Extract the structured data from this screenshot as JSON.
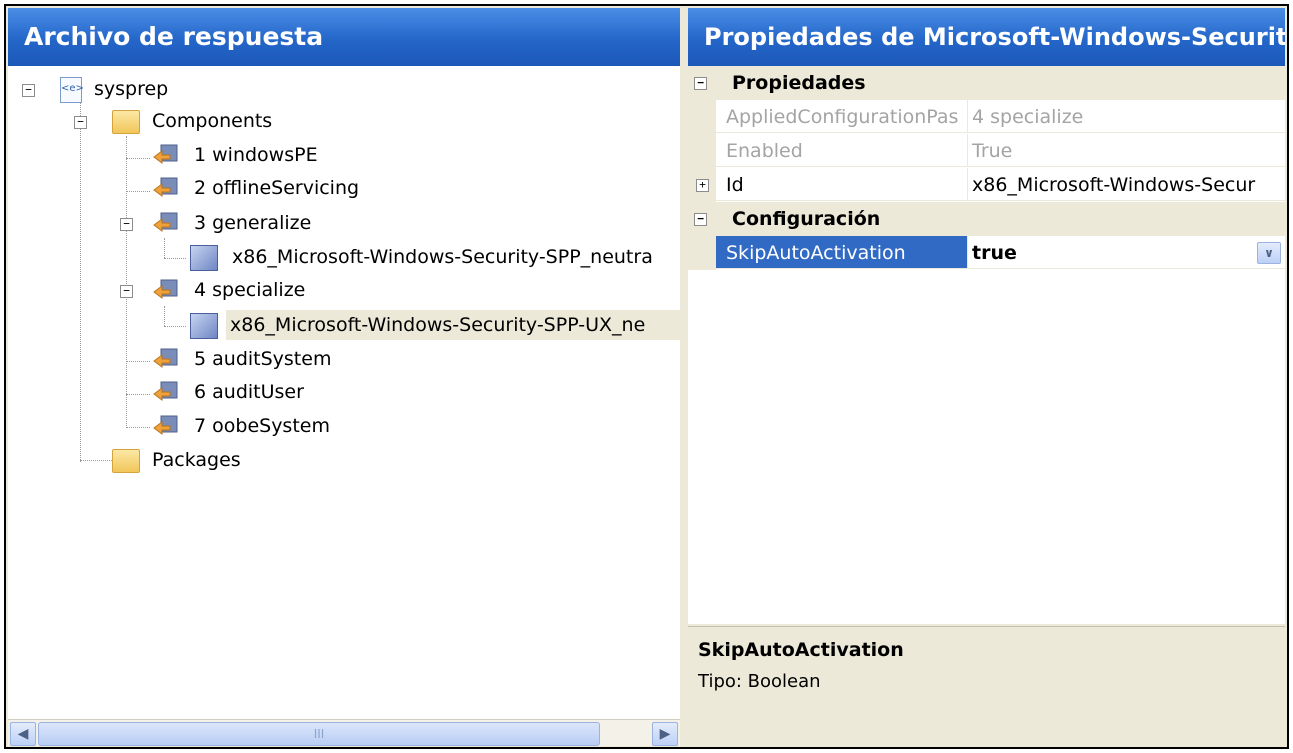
{
  "left_pane": {
    "title": "Archivo de respuesta",
    "tree": [
      {
        "label": "sysprep",
        "icon": "xml-file-icon"
      },
      {
        "label": "Components",
        "icon": "folder-icon"
      },
      {
        "label": "1 windowsPE",
        "icon": "config-pass-icon"
      },
      {
        "label": "2 offlineServicing",
        "icon": "config-pass-icon"
      },
      {
        "label": "3 generalize",
        "icon": "config-pass-icon"
      },
      {
        "label": "x86_Microsoft-Windows-Security-SPP_neutra",
        "icon": "component-icon"
      },
      {
        "label": "4 specialize",
        "icon": "config-pass-icon"
      },
      {
        "label": "x86_Microsoft-Windows-Security-SPP-UX_ne",
        "icon": "component-icon"
      },
      {
        "label": "5 auditSystem",
        "icon": "config-pass-icon"
      },
      {
        "label": "6 auditUser",
        "icon": "config-pass-icon"
      },
      {
        "label": "7 oobeSystem",
        "icon": "config-pass-icon"
      },
      {
        "label": "Packages",
        "icon": "folder-icon"
      }
    ],
    "scrollbar_grip": "III"
  },
  "right_pane": {
    "title": "Propiedades de Microsoft-Windows-Securit",
    "categories": {
      "propiedades": "Propiedades",
      "configuracion": "Configuración"
    },
    "properties": [
      {
        "name": "AppliedConfigurationPas",
        "value": "4 specialize"
      },
      {
        "name": "Enabled",
        "value": "True"
      },
      {
        "name": "Id",
        "value": "x86_Microsoft-Windows-Secur"
      }
    ],
    "settings": [
      {
        "name": "SkipAutoActivation",
        "value": "true"
      }
    ],
    "description": {
      "title": "SkipAutoActivation",
      "text": "Tipo: Boolean"
    }
  }
}
